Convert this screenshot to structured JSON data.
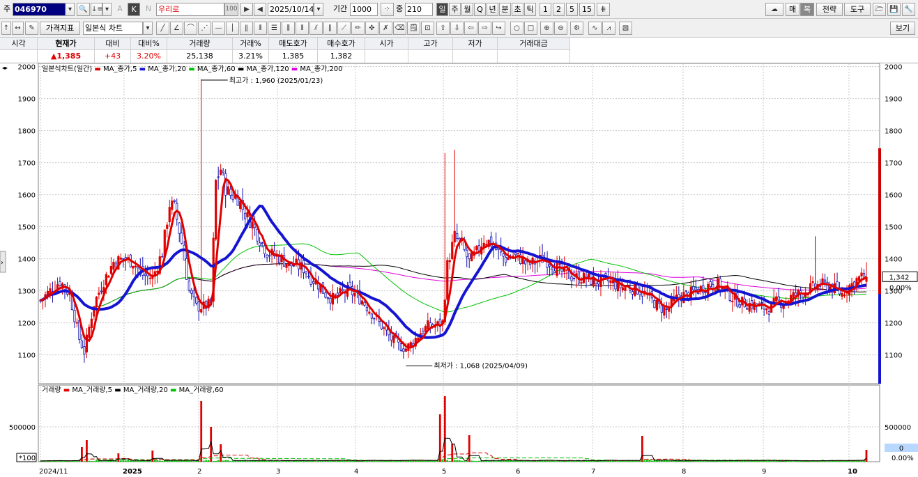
{
  "toolbar1": {
    "market_label": "주",
    "stock_code": "046970",
    "stock_name": "우리로",
    "name_badge": "100",
    "date": "2025/10/14",
    "period_label": "기간",
    "period_value": "1000",
    "count_label": "중",
    "count_value": "210",
    "timeframes": [
      "일",
      "주",
      "월",
      "Q",
      "년",
      "분",
      "초",
      "틱",
      "1",
      "2",
      "5",
      "15"
    ],
    "timeframe_selected": "일",
    "right_buttons": [
      "매",
      "복",
      "전략",
      "도구"
    ],
    "letter_a": "A",
    "letter_k": "K",
    "letter_n": "N"
  },
  "toolbar2": {
    "indicator_btn": "가격지표",
    "chart_type": "일본식 차트",
    "view_btn": "보기"
  },
  "quote": {
    "headers": [
      "시각",
      "현재가",
      "대비",
      "대비%",
      "거래량",
      "거래%",
      "매도호가",
      "매수호가",
      "시가",
      "고가",
      "저가",
      "거래대금"
    ],
    "values": [
      "",
      "▲1,385",
      "+43",
      "3.20%",
      "25,138",
      "3.21%",
      "1,385",
      "1,382",
      "",
      "",
      "",
      ""
    ]
  },
  "colors": {
    "up": "#e00000",
    "down": "#1010b0",
    "ma5": "#e00000",
    "ma20": "#1414d2",
    "ma60": "#00c000",
    "ma120": "#000000",
    "ma200": "#e000e0",
    "grid": "#c8c8c8"
  },
  "chart_data": [
    {
      "type": "candlestick",
      "title": "일본식차트(일간)",
      "legend": [
        "MA_종가,5",
        "MA_종가,20",
        "MA_종가,60",
        "MA_종가,120",
        "MA_종가,200"
      ],
      "ylim": [
        1010,
        2010
      ],
      "yticks": [
        1100,
        1200,
        1300,
        1400,
        1500,
        1600,
        1700,
        1800,
        1900,
        2000
      ],
      "x_ticks": [
        "2024/11",
        "2025",
        "2",
        "3",
        "4",
        "5",
        "6",
        "7",
        "8",
        "9",
        "10"
      ],
      "annotations": [
        {
          "text": "최고가 : 1,960 (2025/01/23)",
          "value": 1960
        },
        {
          "text": "최저가 : 1,068 (2025/04/09)",
          "value": 1068
        }
      ],
      "last_price_label": "1,342",
      "last_change_label": "0.00%",
      "close_keypoints": [
        [
          0,
          1270
        ],
        [
          4,
          1300
        ],
        [
          8,
          1330
        ],
        [
          12,
          1290
        ],
        [
          16,
          1150
        ],
        [
          18,
          1110
        ],
        [
          22,
          1260
        ],
        [
          26,
          1330
        ],
        [
          30,
          1390
        ],
        [
          34,
          1400
        ],
        [
          38,
          1390
        ],
        [
          42,
          1350
        ],
        [
          46,
          1340
        ],
        [
          50,
          1420
        ],
        [
          53,
          1570
        ],
        [
          55,
          1560
        ],
        [
          58,
          1450
        ],
        [
          61,
          1300
        ],
        [
          64,
          1250
        ],
        [
          67,
          1250
        ],
        [
          70,
          1260
        ],
        [
          72,
          1640
        ],
        [
          74,
          1680
        ],
        [
          76,
          1620
        ],
        [
          78,
          1600
        ],
        [
          81,
          1590
        ],
        [
          84,
          1540
        ],
        [
          87,
          1510
        ],
        [
          90,
          1460
        ],
        [
          93,
          1420
        ],
        [
          96,
          1410
        ],
        [
          99,
          1400
        ],
        [
          102,
          1380
        ],
        [
          105,
          1380
        ],
        [
          108,
          1370
        ],
        [
          111,
          1340
        ],
        [
          114,
          1320
        ],
        [
          117,
          1290
        ],
        [
          120,
          1275
        ],
        [
          123,
          1290
        ],
        [
          126,
          1300
        ],
        [
          129,
          1290
        ],
        [
          132,
          1270
        ],
        [
          135,
          1240
        ],
        [
          138,
          1210
        ],
        [
          141,
          1180
        ],
        [
          144,
          1150
        ],
        [
          147,
          1130
        ],
        [
          150,
          1120
        ],
        [
          153,
          1140
        ],
        [
          156,
          1170
        ],
        [
          159,
          1190
        ],
        [
          162,
          1190
        ],
        [
          165,
          1200
        ],
        [
          167,
          1380
        ],
        [
          170,
          1470
        ],
        [
          173,
          1440
        ],
        [
          176,
          1390
        ],
        [
          179,
          1420
        ],
        [
          182,
          1460
        ],
        [
          185,
          1450
        ],
        [
          188,
          1420
        ],
        [
          191,
          1400
        ],
        [
          194,
          1410
        ],
        [
          197,
          1400
        ],
        [
          200,
          1380
        ],
        [
          203,
          1390
        ],
        [
          206,
          1400
        ],
        [
          209,
          1390
        ],
        [
          212,
          1370
        ],
        [
          215,
          1355
        ],
        [
          218,
          1345
        ],
        [
          221,
          1340
        ],
        [
          224,
          1340
        ],
        [
          227,
          1330
        ],
        [
          230,
          1330
        ],
        [
          233,
          1330
        ],
        [
          236,
          1320
        ],
        [
          239,
          1310
        ],
        [
          242,
          1310
        ],
        [
          245,
          1305
        ],
        [
          248,
          1290
        ],
        [
          251,
          1270
        ],
        [
          254,
          1250
        ],
        [
          257,
          1240
        ],
        [
          260,
          1270
        ],
        [
          263,
          1285
        ],
        [
          266,
          1290
        ],
        [
          269,
          1300
        ],
        [
          272,
          1310
        ],
        [
          275,
          1320
        ],
        [
          278,
          1320
        ],
        [
          281,
          1300
        ],
        [
          284,
          1280
        ],
        [
          287,
          1265
        ],
        [
          290,
          1260
        ],
        [
          293,
          1255
        ],
        [
          296,
          1250
        ],
        [
          299,
          1245
        ],
        [
          302,
          1265
        ],
        [
          305,
          1265
        ],
        [
          308,
          1280
        ],
        [
          311,
          1290
        ],
        [
          314,
          1300
        ],
        [
          317,
          1310
        ],
        [
          320,
          1320
        ],
        [
          323,
          1315
        ],
        [
          326,
          1305
        ],
        [
          329,
          1290
        ],
        [
          331,
          1310
        ],
        [
          333,
          1320
        ],
        [
          335,
          1335
        ],
        [
          337,
          1342
        ]
      ],
      "highlight_spikes": [
        {
          "i": 66,
          "high": 1960
        },
        {
          "i": 166,
          "high": 1730
        },
        {
          "i": 170,
          "high": 1740
        },
        {
          "i": 318,
          "high": 1470
        }
      ]
    },
    {
      "type": "bar",
      "title": "거래량",
      "legend": [
        "MA_거래량,5",
        "MA_거래량,20",
        "MA_거래량,60"
      ],
      "yticks": [
        500000
      ],
      "ylim": [
        0,
        1000000
      ],
      "unit_label": "*100",
      "last_value_label": "0",
      "last_change_label": "0.00%",
      "spikes": [
        {
          "i": 17,
          "v": 210000
        },
        {
          "i": 19,
          "v": 310000
        },
        {
          "i": 32,
          "v": 120000
        },
        {
          "i": 46,
          "v": 160000
        },
        {
          "i": 66,
          "v": 870000
        },
        {
          "i": 70,
          "v": 500000
        },
        {
          "i": 74,
          "v": 250000
        },
        {
          "i": 164,
          "v": 680000
        },
        {
          "i": 166,
          "v": 940000
        },
        {
          "i": 169,
          "v": 260000
        },
        {
          "i": 176,
          "v": 380000
        },
        {
          "i": 247,
          "v": 370000
        },
        {
          "i": 339,
          "v": 170000
        }
      ]
    }
  ]
}
